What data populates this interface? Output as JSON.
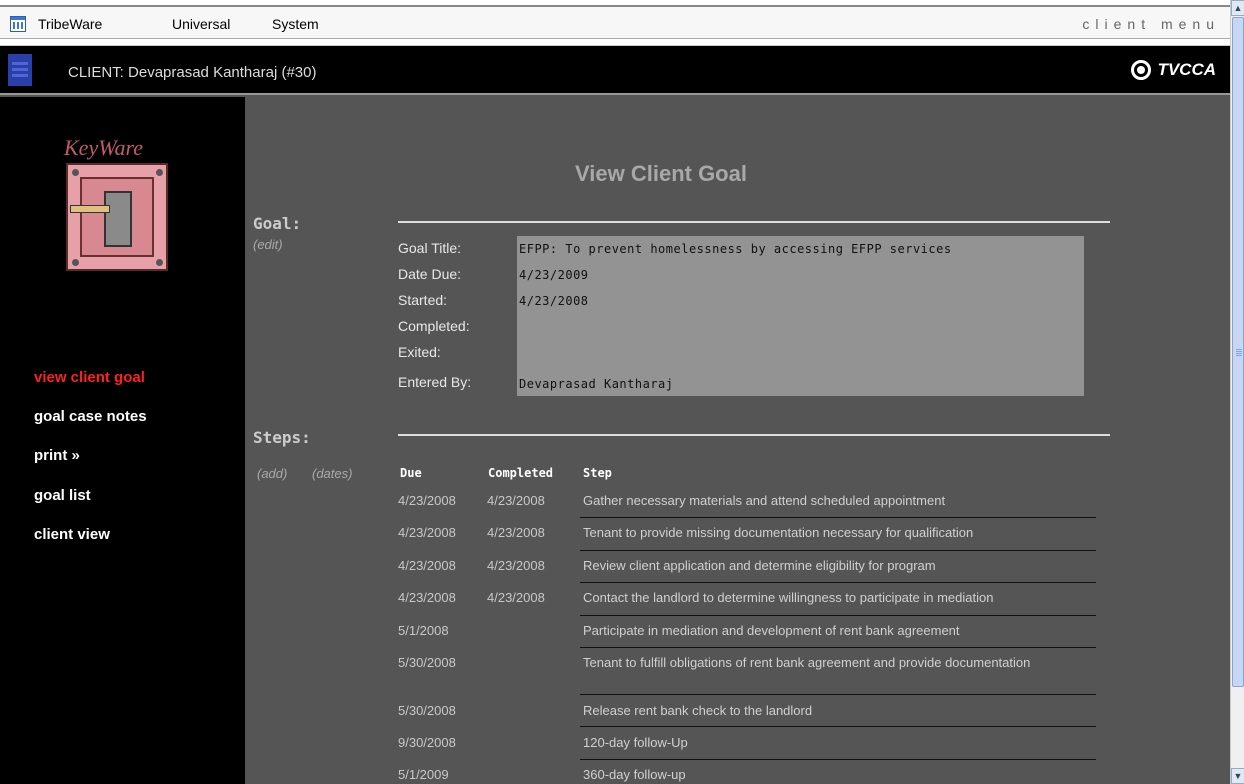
{
  "menubar": {
    "items": [
      "TribeWare",
      "Universal",
      "System"
    ],
    "right_label": "client menu"
  },
  "client_bar": {
    "label": "CLIENT: Devaprasad Kantharaj (#30)",
    "org": "TVCCA"
  },
  "sidebar": {
    "app_name": "KeyWare",
    "nav": [
      {
        "label": "view client goal",
        "active": true
      },
      {
        "label": "goal case notes",
        "active": false
      },
      {
        "label": "print  »",
        "active": false
      },
      {
        "label": "goal list",
        "active": false
      },
      {
        "label": "client view",
        "active": false
      }
    ]
  },
  "main": {
    "title": "View Client Goal",
    "goal_section": {
      "label": "Goal:",
      "edit_link": "(edit)",
      "fields": [
        {
          "label": "Goal Title:",
          "value": "EFPP: To prevent homelessness by accessing EFPP services"
        },
        {
          "label": "Date Due:",
          "value": "4/23/2009"
        },
        {
          "label": "Started:",
          "value": "4/23/2008"
        },
        {
          "label": "Completed:",
          "value": ""
        },
        {
          "label": "Exited:",
          "value": ""
        },
        {
          "label": "Entered By:",
          "value": "Devaprasad Kantharaj"
        }
      ]
    },
    "steps_section": {
      "label": "Steps:",
      "add_link": "(add)",
      "dates_link": "(dates)",
      "headers": {
        "due": "Due",
        "completed": "Completed",
        "step": "Step"
      },
      "rows": [
        {
          "due": "4/23/2008",
          "completed": "4/23/2008",
          "step": "Gather necessary materials and attend scheduled appointment"
        },
        {
          "due": "4/23/2008",
          "completed": "4/23/2008",
          "step": "Tenant to provide missing documentation necessary for qualification"
        },
        {
          "due": "4/23/2008",
          "completed": "4/23/2008",
          "step": "Review client application and determine eligibility for program"
        },
        {
          "due": "4/23/2008",
          "completed": "4/23/2008",
          "step": "Contact the landlord to determine willingness to participate in mediation"
        },
        {
          "due": "5/1/2008",
          "completed": "",
          "step": "Participate in mediation and development of rent bank agreement"
        },
        {
          "due": "5/30/2008",
          "completed": "",
          "step": "Tenant to fulfill obligations of rent bank agreement and provide documentation"
        },
        {
          "due": "5/30/2008",
          "completed": "",
          "step": "Release rent bank check to the landlord"
        },
        {
          "due": "9/30/2008",
          "completed": "",
          "step": "120-day follow-Up"
        },
        {
          "due": "5/1/2009",
          "completed": "",
          "step": "360-day follow-up"
        }
      ]
    }
  },
  "colors": {
    "active_nav": "#ff2020",
    "sidebar_bg": "#000000",
    "main_bg": "#555555",
    "goal_box_bg": "#939393"
  }
}
